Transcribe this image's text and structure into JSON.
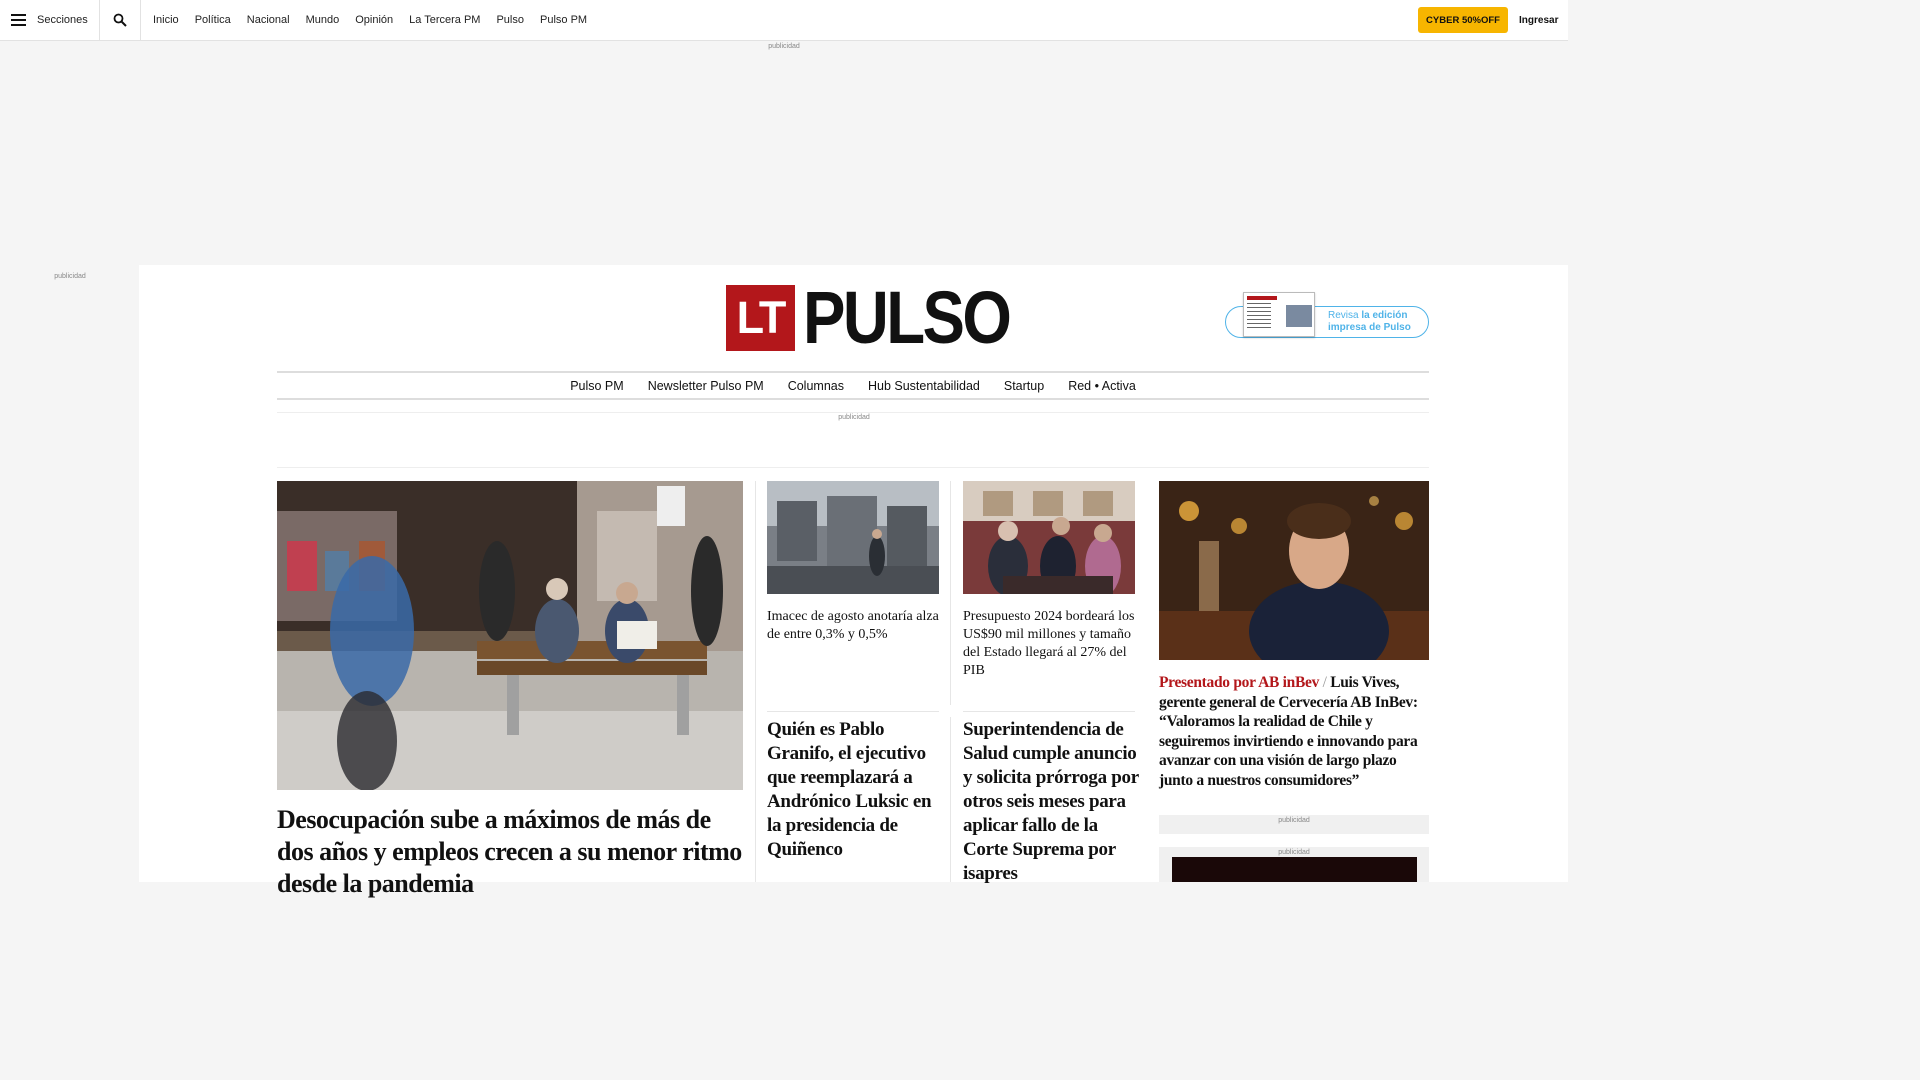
{
  "topbar": {
    "sections_label": "Secciones",
    "nav": [
      "Inicio",
      "Política",
      "Nacional",
      "Mundo",
      "Opinión",
      "La Tercera PM",
      "Pulso",
      "Pulso PM"
    ],
    "cyber_label": "CYBER 50%OFF",
    "login_label": "Ingresar",
    "icons": [
      "menu-icon",
      "search-icon"
    ]
  },
  "ads": {
    "label": "publicidad"
  },
  "brand": {
    "lt": "LT",
    "name": "PULSO",
    "accent_color": "#b3171b",
    "edition_link_prefix": "Revisa ",
    "edition_link_bold": "la edición impresa de Pulso"
  },
  "section_nav": [
    "Pulso PM",
    "Newsletter Pulso PM",
    "Columnas",
    "Hub Sustentabilidad",
    "Startup",
    "Red • Activa"
  ],
  "stories": {
    "main": {
      "headline": "Desocupación sube a máximos de más de dos años y empleos crecen a su menor ritmo desde la pandemia"
    },
    "imacec": {
      "headline": "Imacec de agosto anotaría alza de entre 0,3% y 0,5%"
    },
    "presupuesto": {
      "headline": "Presupuesto 2024 bordeará los US$90 mil millones y tamaño del Estado llegará al 27% del PIB"
    },
    "granifo": {
      "headline": "Quién es Pablo Granifo, el ejecutivo que reemplazará a Andrónico Luksic en la presidencia de Quiñenco"
    },
    "superintendencia": {
      "headline": "Superintendencia de Salud cumple anuncio y solicita prórroga por otros seis meses para aplicar fallo de la Corte Suprema por isapres"
    },
    "sponsored": {
      "sponsor": "Presentado por AB inBev",
      "separator": "/",
      "headline": "Luis Vives, gerente general de Cervecería AB InBev: “Valoramos la realidad de Chile y seguiremos invirtiendo e innovando para avanzar con una visión de largo plazo junto a nuestros consumidores”"
    }
  }
}
